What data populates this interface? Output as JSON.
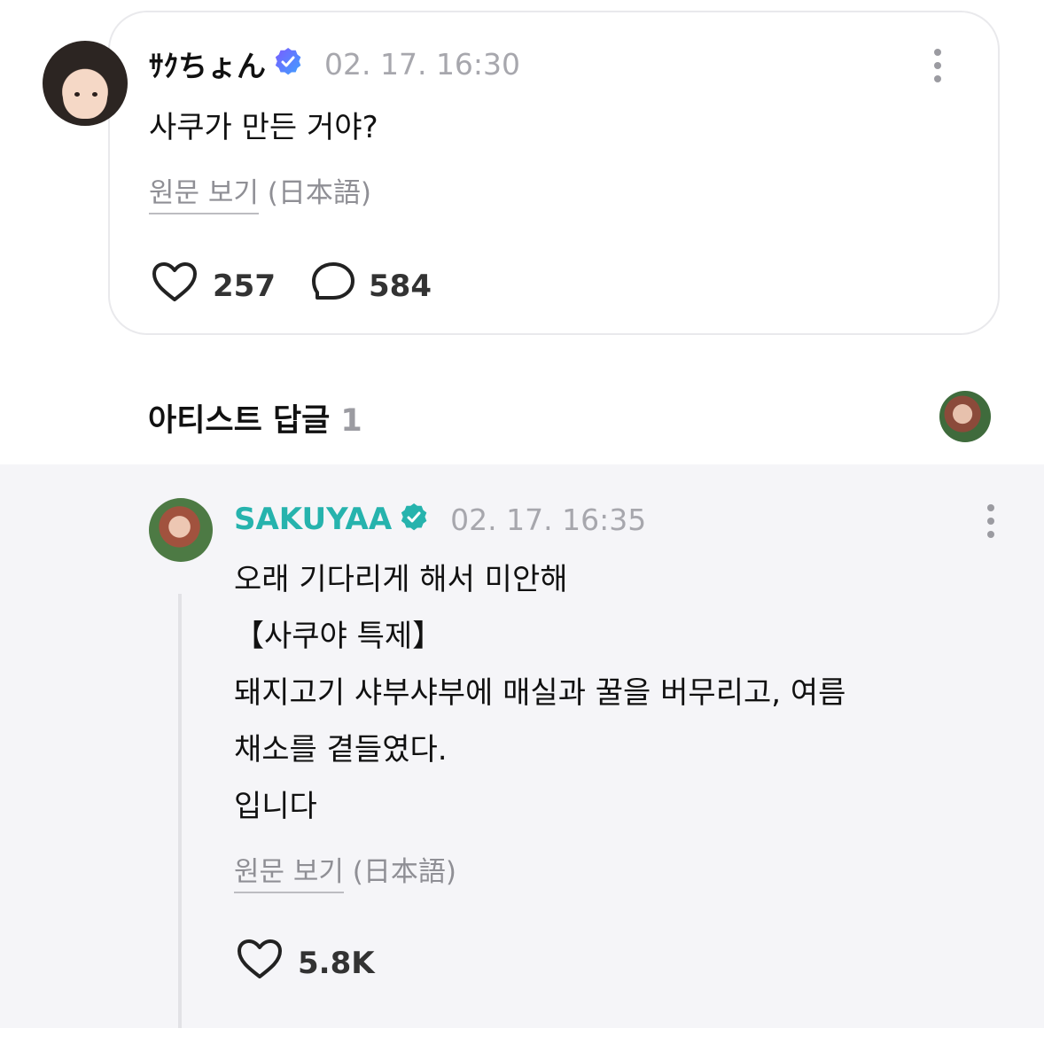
{
  "post": {
    "author": "ｻｸちょん",
    "timestamp": "02. 17. 16:30",
    "text": "사쿠가 만든 거야?",
    "translate_link": "원문 보기",
    "translate_lang": "(日本語)",
    "likes": "257",
    "comments": "584",
    "icons": [
      "verified-badge-icon",
      "more-icon",
      "heart-icon",
      "comment-icon"
    ]
  },
  "artist_replies": {
    "title": "아티스트 답글",
    "count": "1"
  },
  "reply": {
    "author": "SAKUYAA",
    "timestamp": "02. 17. 16:35",
    "text": "오래 기다리게 해서 미안해\n【사쿠야 특제】\n돼지고기 샤부샤부에 매실과 꿀을 버무리고, 여름\n채소를 곁들였다.\n입니다",
    "translate_link": "원문 보기",
    "translate_lang": "(日本語)",
    "likes": "5.8K",
    "accent_color": "#26b3ad"
  }
}
